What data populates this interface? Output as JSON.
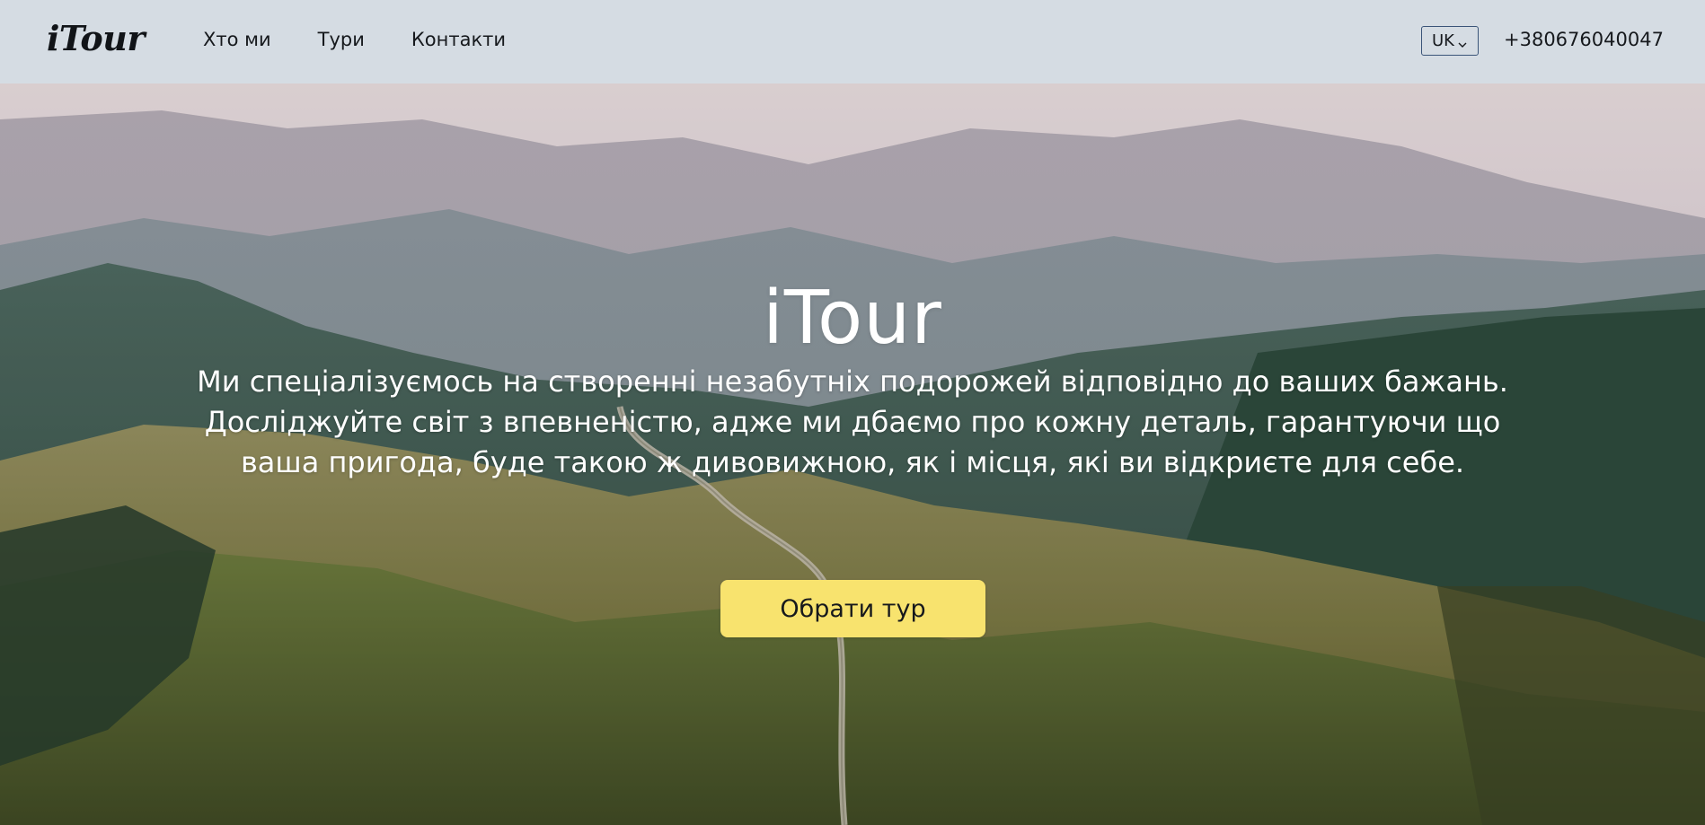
{
  "header": {
    "logo": "iTour",
    "nav": [
      {
        "label": "Хто ми"
      },
      {
        "label": "Тури"
      },
      {
        "label": "Контакти"
      }
    ],
    "language": "UK",
    "phone": "+380676040047"
  },
  "hero": {
    "title": "iTour",
    "text": "Ми спеціалізуємось на створенні незабутніх подорожей відповідно до ваших бажань. Досліджуйте світ з впевненістю, адже ми дбаємо про кожну деталь, гарантуючи що ваша пригода, буде такою ж дивовижною, як і місця, які ви відкриєте для себе.",
    "cta_label": "Обрати тур"
  },
  "colors": {
    "header_bg": "#d5dce3",
    "cta_bg": "#f8e36e",
    "text_dark": "#16191d",
    "lang_border": "#3a5478"
  }
}
